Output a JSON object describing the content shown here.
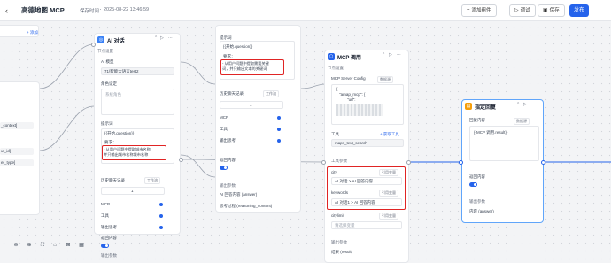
{
  "header": {
    "back_icon": "chevron-left-icon",
    "title": "高德地图 MCP",
    "saved_label": "保存时间：",
    "saved_time": "2025-08-22 13:46:59",
    "add_component": "添加组件",
    "debug": "调试",
    "save": "保存",
    "publish": "发布",
    "accent": "#2563eb"
  },
  "left": {
    "add_label": "添加",
    "rows": [
      "_context]",
      "ut_id]",
      "er_type]"
    ]
  },
  "ai_node": {
    "title": "AI 对话",
    "section_settings": "节点设置",
    "model_label": "AI 模型",
    "model_value": "71\\智能大语言test2",
    "role_label": "角色设定",
    "role_placeholder": "系统角色",
    "prompt_label": "提示词",
    "prompt_var": "{{开始.question}}",
    "extra_label": "要求：",
    "prompt_text": "- 从用户问题中提取城市名称-\n并只输出城市名称城市名称",
    "history_label": "历史聊天记录",
    "history_mode": "工作流",
    "history_count": "1",
    "mcp_label": "MCP",
    "tools_label": "工具",
    "reasoning_label": "输出思考",
    "return_label": "返回内容",
    "output_section": "输出参数",
    "output_answer": "AI 回答内容 (answer)"
  },
  "ai_node2": {
    "prompt_label": "提示词",
    "prompt_var": "{{开始.question}}",
    "extra_label": "要求：",
    "prompt_text": "- 从用户问题中提取需要关键\n词，并只输出文本的关键词",
    "history_label": "历史聊天记录",
    "history_mode": "工作流",
    "history_count": "1",
    "mcp_label": "MCP",
    "tools_label": "工具",
    "reasoning_label": "输出思考",
    "return_label": "返回内容",
    "output_section": "输出参数",
    "output_answer": "AI 回答内容 (answer)",
    "output_reasoning": "思考过程 (reasoning_content)"
  },
  "mcp_node": {
    "title": "MCP 调用",
    "section_settings": "节点设置",
    "config_label": "MCP Server Config",
    "config_mode": "数据源",
    "json_line1": "{",
    "json_line2": "\"amap_mcp\": {",
    "json_line3": "\"url\":",
    "tools_label": "工具",
    "get_tools": "获取工具",
    "tool_value": "maps_text_search",
    "params_label": "工具参数",
    "city_label": "city",
    "city_tag": "引用变量",
    "city_value": "AI 对话 > AI 回答内容",
    "keywords_label": "keywords",
    "keywords_tag": "引用变量",
    "keywords_value": "AI 对话1 > AI 回答内容",
    "citylimit_label": "citylimit",
    "citylimit_tag": "引用变量",
    "citylimit_placeholder": "请选择变量",
    "output_section": "输出参数",
    "output_result": "结果 (result)"
  },
  "reply_node": {
    "title": "指定回复",
    "content_label": "回复内容",
    "content_mode": "数据源",
    "content_value": "{{MCP 调用.result}}",
    "return_label": "返回内容",
    "output_section": "输出参数",
    "output_answer": "内容 (answer)"
  },
  "controls": [
    "zoom-out-icon",
    "zoom-in-icon",
    "fit-view-icon",
    "lock-icon",
    "grid-icon",
    "minimap-icon"
  ]
}
